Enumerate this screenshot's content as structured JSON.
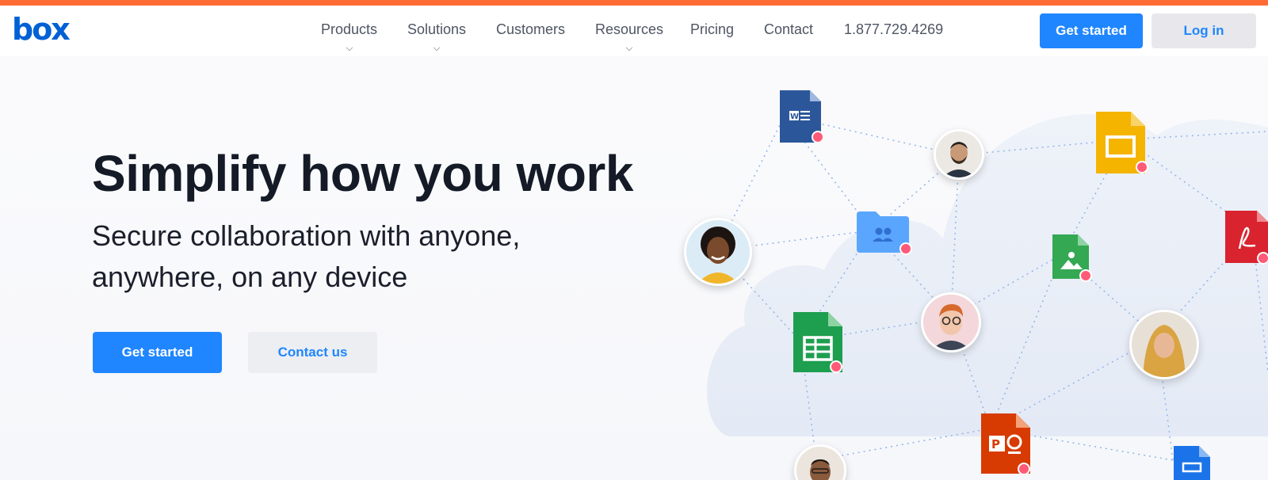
{
  "brand": {
    "logo_text": "box",
    "accent": "#0061d5",
    "top_bar_color": "#ff6b35"
  },
  "nav": {
    "items": [
      {
        "label": "Products",
        "has_dropdown": true
      },
      {
        "label": "Solutions",
        "has_dropdown": true
      },
      {
        "label": "Customers",
        "has_dropdown": false
      },
      {
        "label": "Resources",
        "has_dropdown": true
      },
      {
        "label": "Pricing",
        "has_dropdown": false
      },
      {
        "label": "Contact",
        "has_dropdown": false
      }
    ],
    "phone": "1.877.729.4269"
  },
  "header_actions": {
    "get_started": "Get started",
    "login": "Log in"
  },
  "hero": {
    "title": "Simplify how you work",
    "subtitle": "Secure collaboration with anyone, anywhere, on any device",
    "primary_cta": "Get started",
    "secondary_cta": "Contact us"
  },
  "illustration": {
    "file_icons": [
      "word-doc-icon",
      "google-slides-icon",
      "shared-folder-icon",
      "image-file-icon",
      "pdf-icon",
      "google-sheets-icon",
      "powerpoint-icon",
      "keynote-icon"
    ],
    "colors": {
      "word": "#2b579a",
      "slides": "#f4b400",
      "folder": "#5aa6ff",
      "image": "#34a853",
      "pdf": "#d9232e",
      "sheets": "#1e9e4f",
      "powerpoint": "#d83b01",
      "keynote": "#1a73e8",
      "lock_badge": "#ff5a78"
    }
  }
}
